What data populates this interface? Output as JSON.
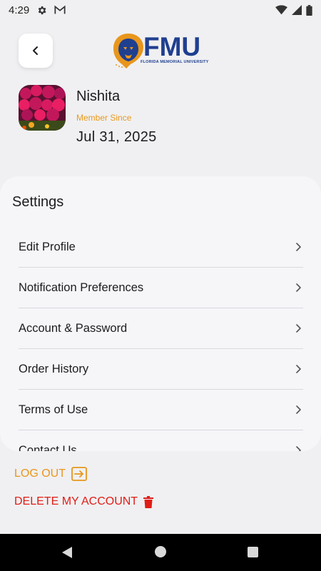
{
  "status_bar": {
    "time": "4:29",
    "icons": [
      "settings-icon",
      "gmail-icon",
      "wifi-icon",
      "signal-icon",
      "battery-icon"
    ]
  },
  "header": {
    "back_icon": "chevron-left-icon",
    "logo_text": "FMU",
    "logo_subtitle": "FLORIDA MEMORIAL UNIVERSITY"
  },
  "profile": {
    "name": "Nishita",
    "member_since_label": "Member Since",
    "member_since_date": "Jul 31, 2025"
  },
  "settings": {
    "title": "Settings",
    "items": [
      {
        "label": "Edit Profile"
      },
      {
        "label": "Notification Preferences"
      },
      {
        "label": "Account & Password"
      },
      {
        "label": "Order History"
      },
      {
        "label": "Terms of Use"
      },
      {
        "label": "Contact Us"
      }
    ]
  },
  "actions": {
    "logout_label": "LOG OUT",
    "delete_label": "DELETE MY ACCOUNT"
  },
  "colors": {
    "accent_orange": "#e8961c",
    "danger_red": "#e01d16",
    "brand_blue": "#1f3f8f"
  }
}
